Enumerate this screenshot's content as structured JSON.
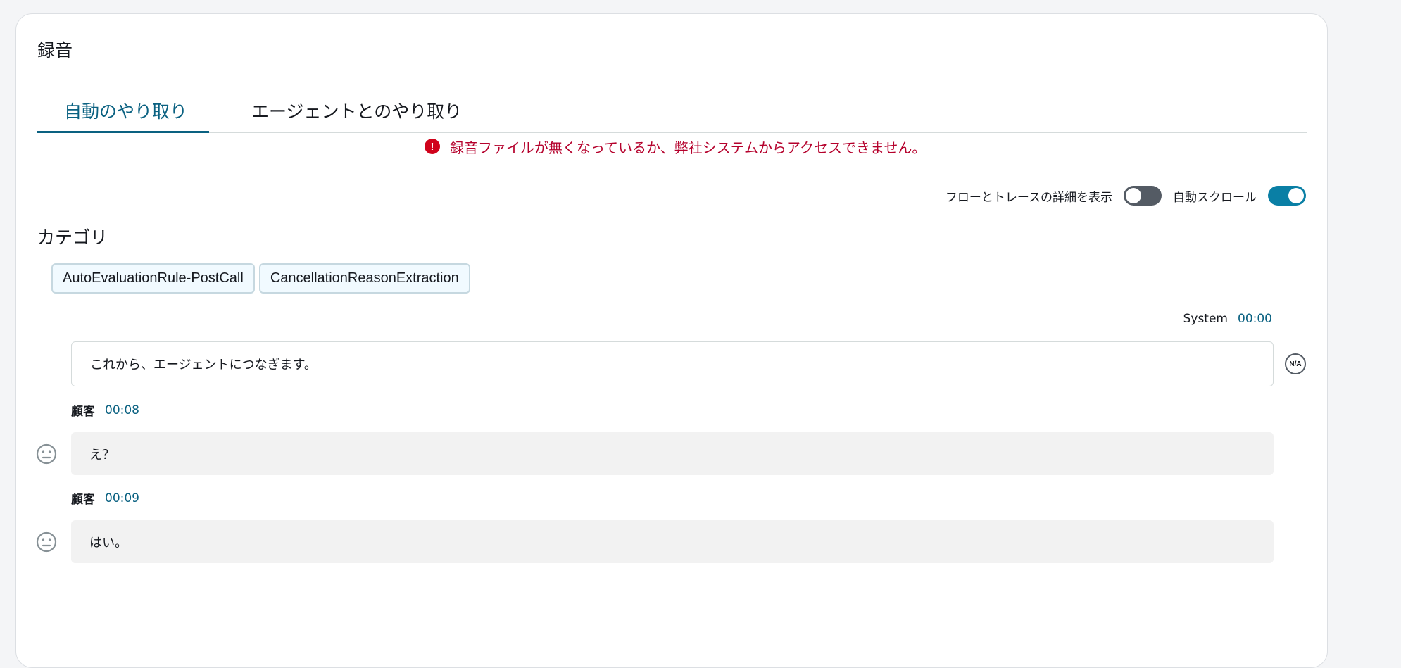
{
  "section": {
    "title": "録音"
  },
  "tabs": [
    {
      "label": "自動のやり取り",
      "active": true
    },
    {
      "label": "エージェントとのやり取り",
      "active": false
    }
  ],
  "error": {
    "icon": "exclamation-icon",
    "text": "録音ファイルが無くなっているか、弊社システムからアクセスできません。"
  },
  "toggles": [
    {
      "label": "フローとトレースの詳細を表示",
      "on": false
    },
    {
      "label": "自動スクロール",
      "on": true
    }
  ],
  "categories": {
    "title": "カテゴリ",
    "chips": [
      "AutoEvaluationRule-PostCall",
      "CancellationReasonExtraction"
    ]
  },
  "transcript": [
    {
      "speaker": "System",
      "time": "00:00",
      "text": "これから、エージェントにつなぎます。",
      "badge": "N/A"
    },
    {
      "speaker": "顧客",
      "time": "00:08",
      "text": "え？",
      "sentiment": "neutral"
    },
    {
      "speaker": "顧客",
      "time": "00:09",
      "text": "はい。",
      "sentiment": "neutral"
    }
  ],
  "colors": {
    "accent": "#0a6181",
    "error": "#b5012c",
    "toggle_on": "#0a7fa5"
  }
}
